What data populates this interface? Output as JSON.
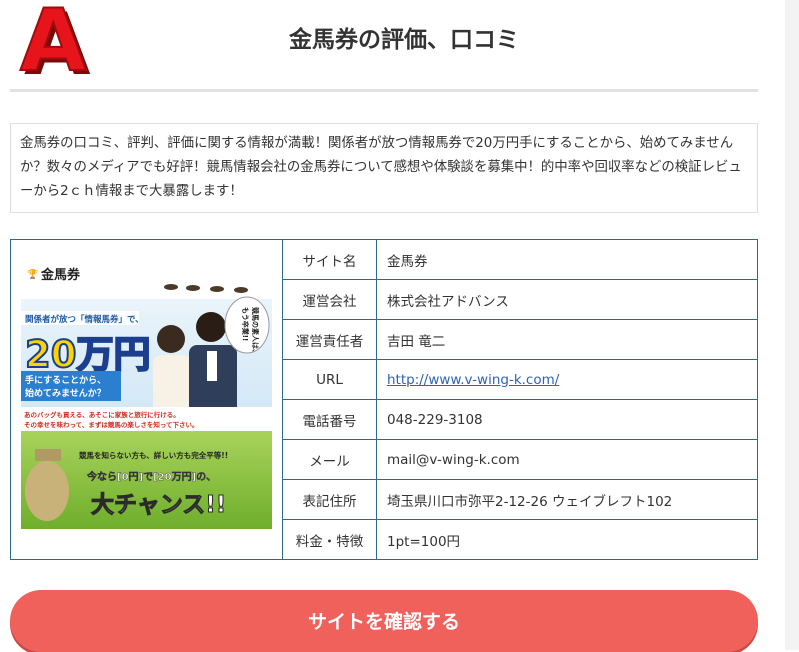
{
  "header": {
    "grade": "A",
    "title": "金馬券の評価、口コミ"
  },
  "description": "金馬券の口コミ、評判、評価に関する情報が満載！関係者が放つ情報馬券で20万円手にすることから、始めてみませんか？数々のメディアでも好評！競馬情報会社の金馬券について感想や体験談を募集中！的中率や回収率などの検証レビューから2ｃｈ情報まで大暴露します！",
  "banner": {
    "logo_text": "金馬券",
    "headline": "関係者が放つ「情報馬券」で、",
    "amount": "20万円",
    "sub_lines": [
      "手にすることから、",
      "始めてみませんか？"
    ],
    "bubble_lines": [
      "競馬の素人は、",
      "もう卒業!!"
    ],
    "body_lines": [
      "あのバッグも買える、あそこに家族と旅行に行ける。",
      "その幸せを味わって、まずは競馬の楽しさを知って下さい。"
    ],
    "promo_small": "競馬を知らない方も、詳しい方も完全平等!!",
    "promo_mid": "今なら[0円]で[20万円]の、",
    "promo_big": "大チャンス!!"
  },
  "info": [
    {
      "label": "サイト名",
      "value": "金馬券"
    },
    {
      "label": "運営会社",
      "value": "株式会社アドバンス"
    },
    {
      "label": "運営責任者",
      "value": "吉田 竜二"
    },
    {
      "label": "URL",
      "value": "http://www.v-wing-k.com/"
    },
    {
      "label": "電話番号",
      "value": "048-229-3108"
    },
    {
      "label": "メール",
      "value": "mail@v-wing-k.com"
    },
    {
      "label": "表記住所",
      "value": "埼玉県川口市弥平2-12-26 ウェイブレフト102"
    },
    {
      "label": "料金・特徴",
      "value": "1pt=100円"
    }
  ],
  "cta": {
    "label": "サイトを確認する"
  },
  "colors": {
    "accent": "#f0615c",
    "table_border": "#2b6a8f",
    "link": "#2f63b1",
    "grade_red": "#e8141b"
  }
}
